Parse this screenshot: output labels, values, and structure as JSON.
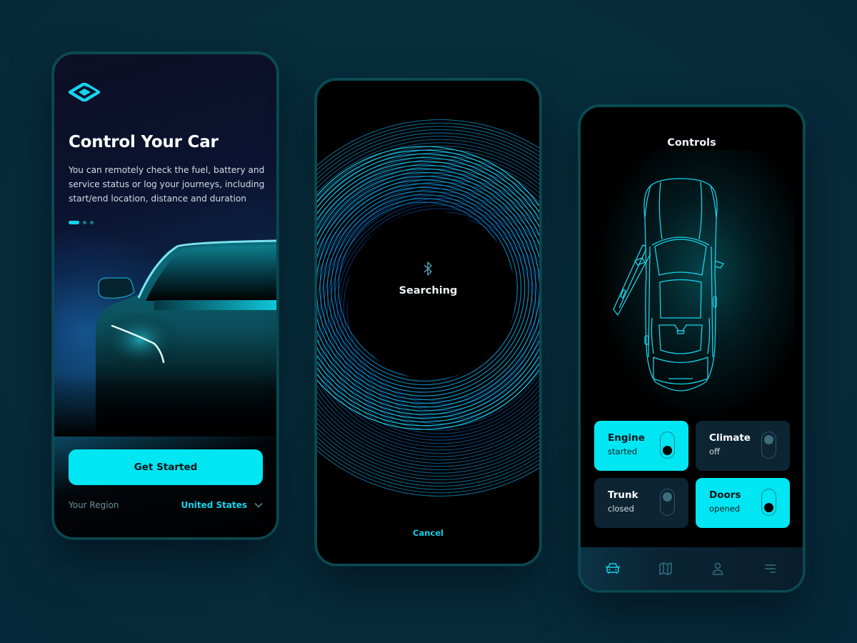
{
  "theme": {
    "accent": "#00e6f2",
    "background": "#072c3b",
    "tile_off": "#0d2433",
    "muted_text": "#6a8e9a"
  },
  "onboarding": {
    "logo_icon": "diamond-logo-icon",
    "title": "Control Your Car",
    "description": "You can remotely check the fuel, battery and service status or log your journeys, including start/end location, distance and duration",
    "pagination": {
      "total": 3,
      "active_index": 0
    },
    "cta_label": "Get Started",
    "region_label": "Your Region",
    "region_value": "United States",
    "region_icon": "chevron-down-icon"
  },
  "search": {
    "status_icon": "bluetooth-icon",
    "status_label": "Searching",
    "cancel_label": "Cancel"
  },
  "controls": {
    "title": "Controls",
    "tiles": [
      {
        "name": "Engine",
        "state": "started",
        "on": true
      },
      {
        "name": "Climate",
        "state": "off",
        "on": false
      },
      {
        "name": "Trunk",
        "state": "closed",
        "on": false
      },
      {
        "name": "Doors",
        "state": "opened",
        "on": true
      }
    ],
    "tabbar": [
      {
        "icon": "car-icon",
        "active": true
      },
      {
        "icon": "map-icon",
        "active": false
      },
      {
        "icon": "user-icon",
        "active": false
      },
      {
        "icon": "menu-icon",
        "active": false
      }
    ]
  }
}
